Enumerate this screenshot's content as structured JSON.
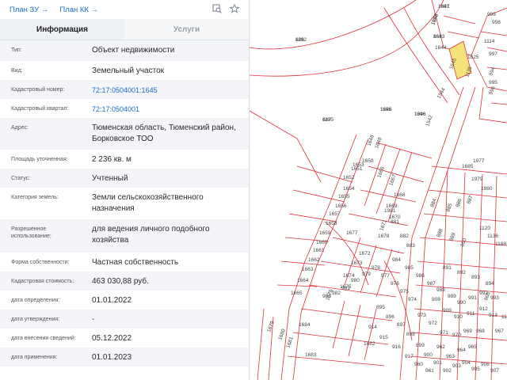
{
  "topbar": {
    "plan_zu": "План ЗУ →",
    "plan_kk": "План КК →",
    "icons": [
      "search-map-icon",
      "star-icon"
    ]
  },
  "tabs": [
    {
      "label": "Информация",
      "active": true
    },
    {
      "label": "Услуги",
      "active": false
    }
  ],
  "info": {
    "type_label": "Тип:",
    "type_value": "Объект недвижимости",
    "kind_label": "Вид:",
    "kind_value": "Земельный участок",
    "cad_num_label": "Кадастровый номер:",
    "cad_num_value": "72:17:0504001:1645",
    "cad_q_label": "Кадастровый квартал:",
    "cad_q_value": "72:17:0504001",
    "addr_label": "Адрес:",
    "addr_value": "Тюменская область, Тюменский район, Борковское ТОО",
    "area_label": "Площадь уточненная:",
    "area_value": "2 236 кв. м",
    "status_label": "Статус:",
    "status_value": "Учтенный",
    "cat_label": "Категория земель:",
    "cat_value": "Земли сельскохозяйственного назначения",
    "use_label": "Разрешенное использование:",
    "use_value": "для ведения личного подобного хозяйства",
    "own_label": "Форма собственности:",
    "own_value": "Частная собственность",
    "cost_label": "Кадастровая стоимость:",
    "cost_value": "463 030,88 руб.",
    "d_def_label": "дата определения:",
    "d_def_value": "01.01.2022",
    "d_app_label": "дата утверждения:",
    "d_app_value": "-",
    "d_ins_label": "дата внесения сведений:",
    "d_ins_value": "05.12.2022",
    "d_use_label": "дата применения:",
    "d_use_value": "01.01.2023"
  },
  "map": {
    "line_color": "#e0303a",
    "highlight_color": "#f5e27a",
    "selected_parcel": "1645",
    "labels": [
      "686",
      "687",
      "1646",
      "1646",
      "1641",
      "1642",
      "1643",
      "1644",
      "1645",
      "1625",
      "1135",
      "1542",
      "1544",
      "1648",
      "1649",
      "1650",
      "1651",
      "1652",
      "1653",
      "1654",
      "1655",
      "1656",
      "1657",
      "1658",
      "1659",
      "1660",
      "1661",
      "1662",
      "1663",
      "1664",
      "1665",
      "1666",
      "1667",
      "1668",
      "1669",
      "1670",
      "1671",
      "1672",
      "1673",
      "1674",
      "1675",
      "1676",
      "1677",
      "1678",
      "1679",
      "1680",
      "1681",
      "1682",
      "1683",
      "1684",
      "1685",
      "1977",
      "1979",
      "1980",
      "1981",
      "881",
      "882",
      "883",
      "884",
      "885",
      "886",
      "887",
      "888",
      "889",
      "890",
      "891",
      "892",
      "893",
      "894",
      "895",
      "896",
      "897",
      "898",
      "899",
      "900",
      "901",
      "902",
      "903",
      "904",
      "905",
      "906",
      "907",
      "908",
      "909",
      "910",
      "911",
      "912",
      "913",
      "914",
      "915",
      "916",
      "917",
      "960",
      "961",
      "962",
      "963",
      "964",
      "965",
      "966",
      "967",
      "968",
      "969",
      "970",
      "971",
      "972",
      "973",
      "974",
      "975",
      "976",
      "977",
      "978",
      "979",
      "980",
      "981",
      "982",
      "983",
      "984",
      "985",
      "986",
      "987",
      "988",
      "989",
      "990",
      "991",
      "992",
      "993",
      "994",
      "995",
      "996",
      "997",
      "998",
      "999",
      "1114",
      "1120",
      "1136",
      "1188",
      "1190",
      "1192",
      "1195",
      "1196",
      "1996",
      "1997",
      "1998",
      "868"
    ]
  }
}
